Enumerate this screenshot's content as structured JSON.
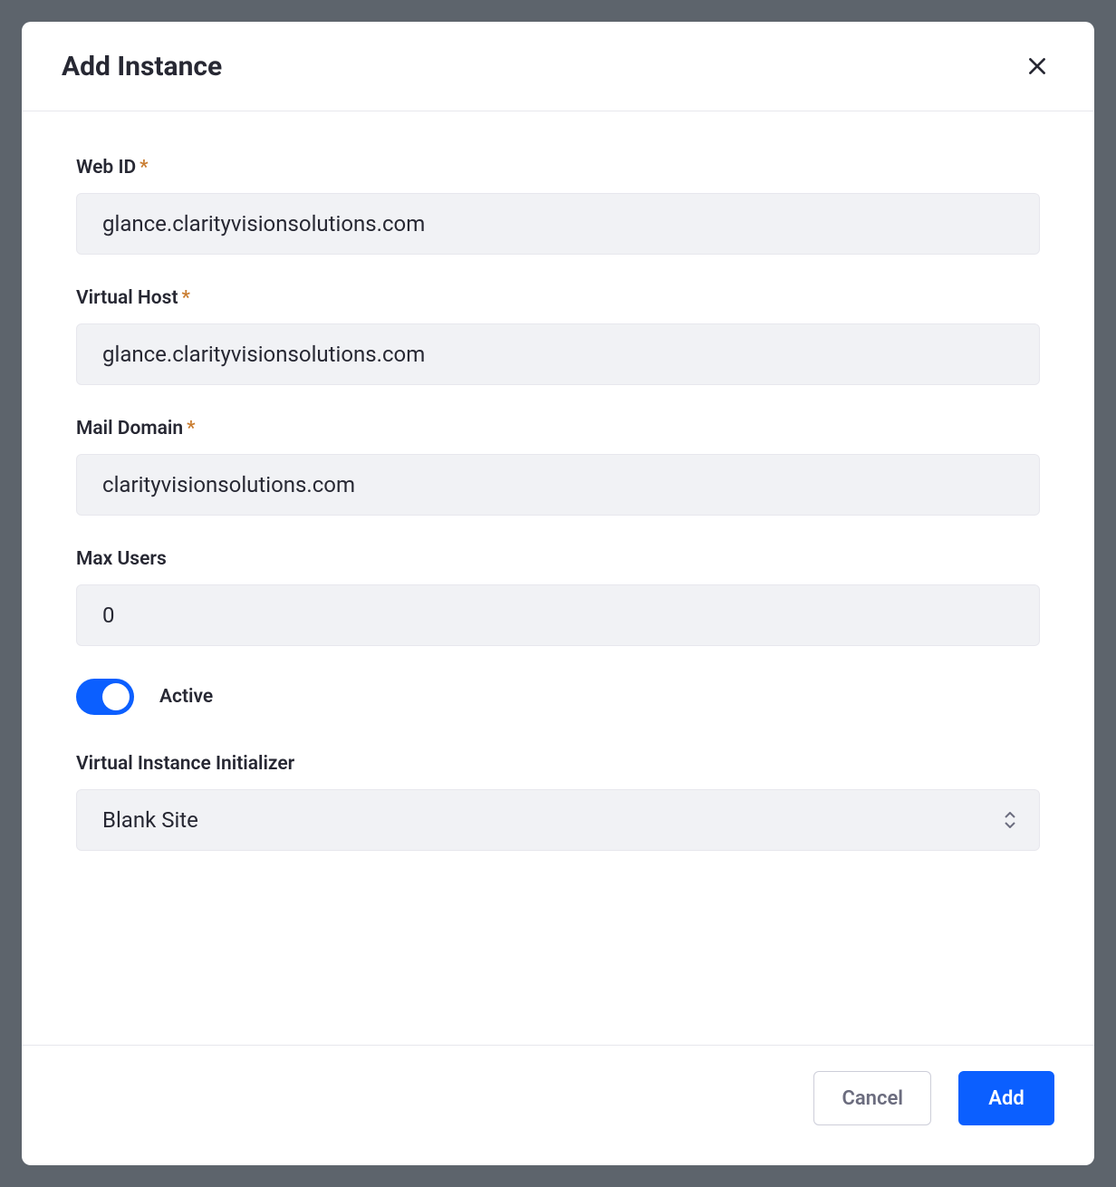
{
  "modal": {
    "title": "Add Instance"
  },
  "form": {
    "webId": {
      "label": "Web ID",
      "value": "glance.clarityvisionsolutions.com",
      "required": true
    },
    "virtualHost": {
      "label": "Virtual Host",
      "value": "glance.clarityvisionsolutions.com",
      "required": true
    },
    "mailDomain": {
      "label": "Mail Domain",
      "value": "clarityvisionsolutions.com",
      "required": true
    },
    "maxUsers": {
      "label": "Max Users",
      "value": "0"
    },
    "active": {
      "label": "Active",
      "on": true
    },
    "initializer": {
      "label": "Virtual Instance Initializer",
      "selected": "Blank Site"
    }
  },
  "footer": {
    "cancel": "Cancel",
    "add": "Add"
  }
}
